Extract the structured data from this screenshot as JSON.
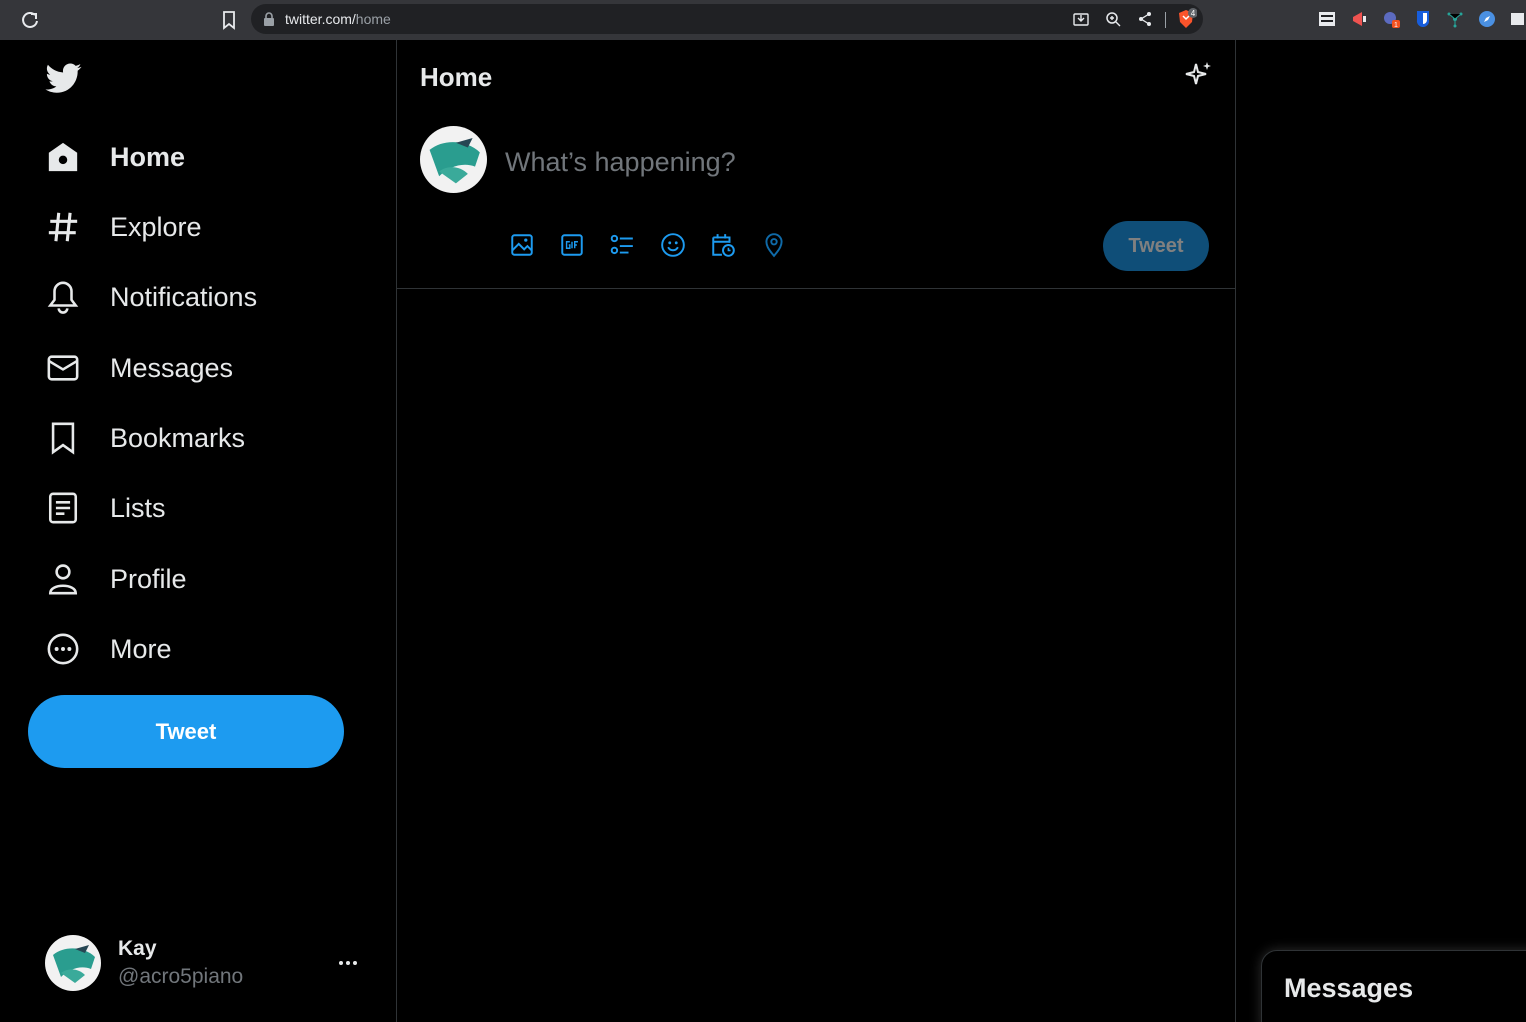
{
  "browser": {
    "url_host": "twitter.com/",
    "url_path": "home",
    "brave_badge": "4",
    "ext_badge": "1"
  },
  "sidebar": {
    "items": [
      {
        "label": "Home",
        "icon": "home-icon"
      },
      {
        "label": "Explore",
        "icon": "hashtag-icon"
      },
      {
        "label": "Notifications",
        "icon": "bell-icon"
      },
      {
        "label": "Messages",
        "icon": "envelope-icon"
      },
      {
        "label": "Bookmarks",
        "icon": "bookmark-icon"
      },
      {
        "label": "Lists",
        "icon": "list-icon"
      },
      {
        "label": "Profile",
        "icon": "person-icon"
      },
      {
        "label": "More",
        "icon": "more-circle-icon"
      }
    ],
    "tweet_label": "Tweet",
    "account": {
      "name": "Kay",
      "handle": "@acro5piano"
    }
  },
  "main": {
    "title": "Home",
    "composer": {
      "placeholder": "What’s happening?",
      "tweet_label": "Tweet",
      "tools": [
        "media-icon",
        "gif-icon",
        "poll-icon",
        "emoji-icon",
        "schedule-icon",
        "location-icon"
      ]
    }
  },
  "messages_drawer": {
    "label": "Messages"
  },
  "colors": {
    "accent": "#1d9bf0",
    "accent_disabled": "#0f4e78",
    "background": "#000000",
    "text": "#e7e9ea",
    "muted": "#71767b",
    "border": "#2f3336"
  }
}
